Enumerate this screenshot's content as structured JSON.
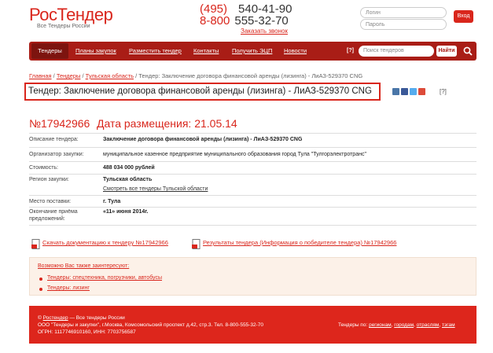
{
  "header": {
    "logo_part1": "Рос",
    "logo_part2": "Тендер",
    "logo_sub": "Все Тендеры России",
    "phone1_code": "(495)",
    "phone1_number": "540-41-90",
    "phone2_code": "8-800",
    "phone2_number": "555-32-70",
    "callback": "Заказать звонок",
    "login_placeholder": "Логин",
    "password_placeholder": "Пароль",
    "login_button": "Вход"
  },
  "nav": {
    "items": [
      "Тендеры",
      "Планы закупок",
      "Разместить тендер",
      "Контакты",
      "Получить ЭЦП",
      "Новости"
    ],
    "help": "[?]",
    "search_placeholder": "Поиск тендеров",
    "search_button": "Найти"
  },
  "breadcrumbs": {
    "home": "Главная",
    "sep": " / ",
    "tenders": "Тендеры",
    "region": "Тульская область",
    "current": "Тендер: Заключение договора финансовой аренды (лизинга) - ЛиАЗ-529370 CNG"
  },
  "title": "Тендер: Заключение договора финансовой аренды (лизинга) - ЛиАЗ-529370 CNG",
  "share_help": "[?]",
  "tender": {
    "number": "№17942966",
    "date_label": "Дата размещения: 21.05.14",
    "rows": [
      {
        "label": "Описание тендера:",
        "value": "Заключение договора финансовой аренды (лизинга) - ЛиАЗ-529370 CNG"
      },
      {
        "label": "Организатор закупки:",
        "value": "муниципальное казенное предприятие муниципального образования город Тула \"Тулгорэлектротранс\""
      },
      {
        "label": "Стоимость:",
        "value": "488 034 000 рублей"
      },
      {
        "label": "Регион закупки:",
        "value": "Тульская область",
        "link": "Смотреть все тендеры Тульской области"
      },
      {
        "label": "Место поставки:",
        "value": "г. Тула"
      },
      {
        "label": "Окончание приёма",
        "label2": "предложений:",
        "value": "«11» июня 2014г."
      }
    ]
  },
  "downloads": {
    "doc": "Скачать документацию к тендеру №17942966",
    "results": "Результаты тендера (Информация о победителе тендера) №17942966"
  },
  "maybe": {
    "heading": "Возможно Вас также заинтересуют:",
    "items": [
      "Тендеры: спецтехника, погрузчики, автобусы",
      "Тендеры: лизинг"
    ]
  },
  "footer": {
    "copyright_symbol": "©",
    "brand_link": "Ростендер",
    "brand_rest": " — Все тендеры России",
    "line2": "ООО \"Тендеры и закупки\", г.Москва, Комсомольский проспект д.42, стр.3. Тел. 8-800-555-32-70",
    "line3": "ОГРН: 1117746910160, ИНН: 7703756587",
    "right_prefix": "Тендеры по:",
    "right_links": [
      "регионам",
      "городам",
      "отраслям",
      "тэгам"
    ]
  },
  "colors": {
    "brand_red": "#d9261c",
    "nav_dark": "#a91d16",
    "footer_red": "#dd261c"
  }
}
